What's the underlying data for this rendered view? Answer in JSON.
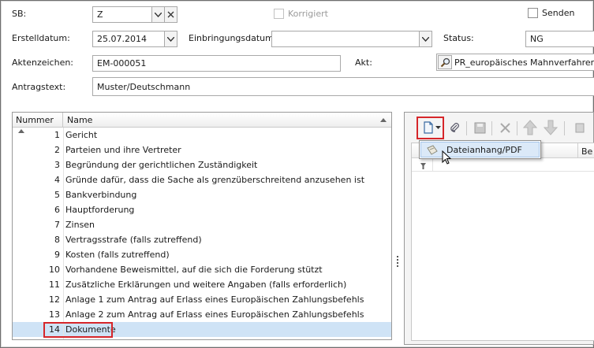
{
  "form": {
    "sb": {
      "label": "SB:",
      "value": "Z"
    },
    "korrigiert": {
      "label": "Korrigiert",
      "checked": false
    },
    "senden": {
      "label": "Senden",
      "checked": false
    },
    "erstelldatum": {
      "label": "Erstelldatum:",
      "value": "25.07.2014"
    },
    "einbringungsdatum": {
      "label": "Einbringungsdatum:",
      "value": ""
    },
    "status": {
      "label": "Status:",
      "value": "NG"
    },
    "aktenzeichen": {
      "label": "Aktenzeichen:",
      "value": "EM-000051"
    },
    "akt": {
      "label": "Akt:",
      "value": "PR_europäisches Mahnverfahren"
    },
    "antragstext": {
      "label": "Antragstext:",
      "value": "Muster/Deutschmann"
    }
  },
  "grid": {
    "columns": [
      "Nummer",
      "Name"
    ],
    "rows": [
      {
        "num": "1",
        "name": "Gericht"
      },
      {
        "num": "2",
        "name": "Parteien und ihre Vertreter"
      },
      {
        "num": "3",
        "name": "Begründung der gerichtlichen Zuständigkeit"
      },
      {
        "num": "4",
        "name": "Gründe dafür, dass die Sache als grenzüberschreitend anzusehen ist"
      },
      {
        "num": "5",
        "name": "Bankverbindung"
      },
      {
        "num": "6",
        "name": "Hauptforderung"
      },
      {
        "num": "7",
        "name": "Zinsen"
      },
      {
        "num": "8",
        "name": "Vertragsstrafe (falls zutreffend)"
      },
      {
        "num": "9",
        "name": "Kosten (falls zutreffend)"
      },
      {
        "num": "10",
        "name": "Vorhandene Beweismittel, auf die sich die Forderung stützt"
      },
      {
        "num": "11",
        "name": "Zusätzliche Erklärungen und weitere Angaben (falls erforderlich)"
      },
      {
        "num": "12",
        "name": "Anlage 1 zum Antrag auf Erlass eines Europäischen Zahlungsbefehls"
      },
      {
        "num": "13",
        "name": "Anlage 2 zum Antrag auf Erlass eines Europäischen Zahlungsbefehls"
      },
      {
        "num": "14",
        "name": "Dokumente"
      }
    ],
    "selected_index": 13
  },
  "right_panel": {
    "column_header_partial": "Be",
    "menu": {
      "item_label": "Dateianhang/PDF"
    }
  },
  "icons": {
    "new_doc": "new-document-icon",
    "attach": "paperclip-icon",
    "save": "save-icon",
    "delete": "delete-icon",
    "up": "arrow-up-icon",
    "down": "arrow-down-icon"
  },
  "colors": {
    "highlight_red": "#d6262a",
    "selection_blue": "#cfe3f6",
    "menu_hover": "#dbe9f8"
  }
}
